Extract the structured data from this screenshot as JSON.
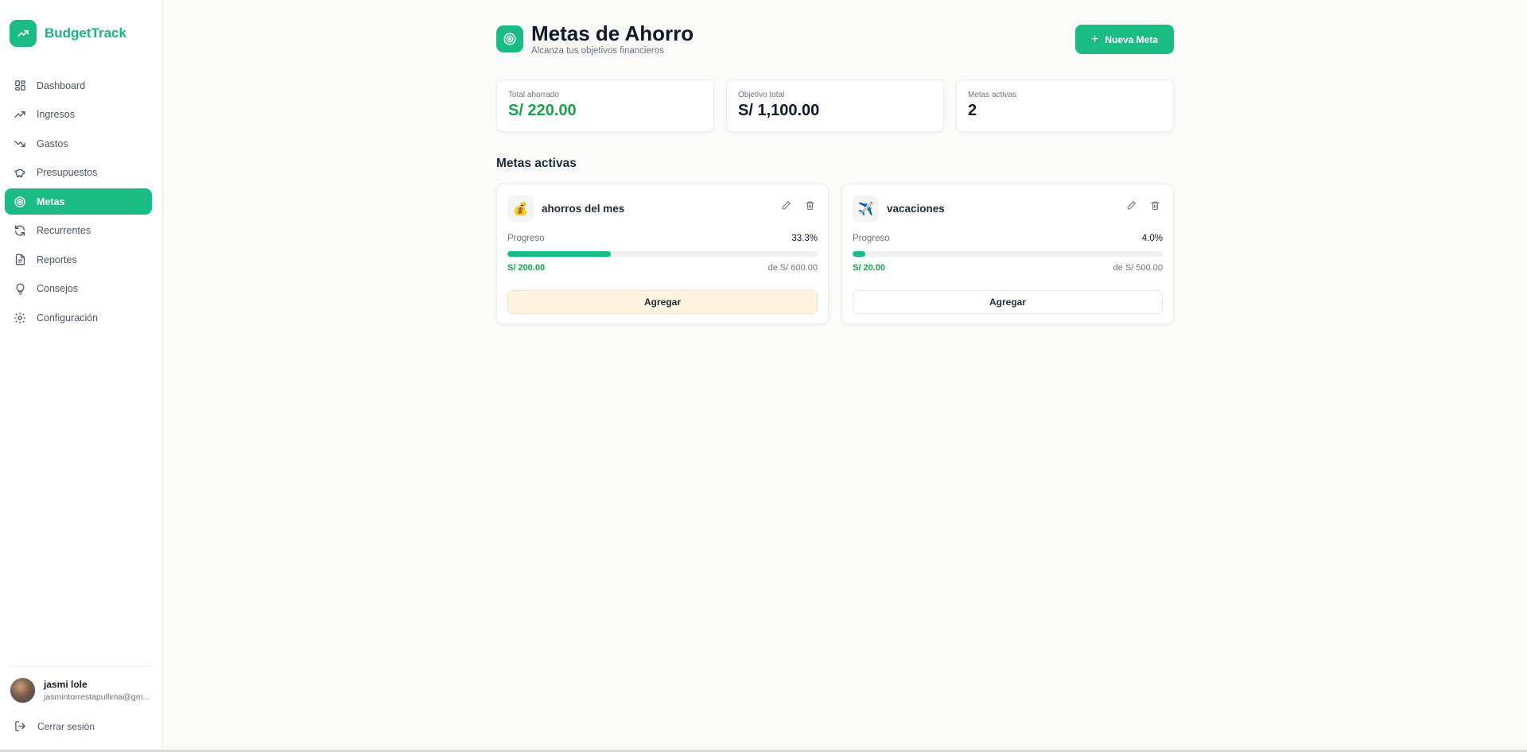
{
  "brand": {
    "name": "BudgetTrack",
    "color": "#1abc84"
  },
  "sidebar": {
    "items": [
      {
        "label": "Dashboard",
        "icon": "grid-icon",
        "active": false
      },
      {
        "label": "Ingresos",
        "icon": "trending-up-icon",
        "active": false
      },
      {
        "label": "Gastos",
        "icon": "trending-down-icon",
        "active": false
      },
      {
        "label": "Presupuestos",
        "icon": "piggy-bank-icon",
        "active": true
      },
      {
        "label": "Metas",
        "icon": "target-icon",
        "active": true
      },
      {
        "label": "Recurrentes",
        "icon": "refresh-icon",
        "active": false
      },
      {
        "label": "Reportes",
        "icon": "file-text-icon",
        "active": false
      },
      {
        "label": "Consejos",
        "icon": "lightbulb-icon",
        "active": false
      },
      {
        "label": "Configuración",
        "icon": "gear-icon",
        "active": false
      }
    ]
  },
  "user": {
    "name": "jasmi lole",
    "email": "jasmintorrestapullima@gm..."
  },
  "logout": {
    "label": "Cerrar sesión"
  },
  "header": {
    "title": "Metas de Ahorro",
    "subtitle": "Alcanza tus objetivos financieros",
    "new_button": "Nueva Meta"
  },
  "stats": [
    {
      "label": "Total ahorrado",
      "value": "S/ 220.00"
    },
    {
      "label": "Objetivo total",
      "value": "S/ 1,100.00"
    },
    {
      "label": "Metas activas",
      "value": "2"
    }
  ],
  "section": {
    "title": "Metas activas"
  },
  "goals": [
    {
      "emoji": "💰",
      "name": "ahorros del mes",
      "progress_label": "Progreso",
      "progress_text": "33.3%",
      "progress": 0.333,
      "saved": "S/ 200.00",
      "target": "de S/ 600.00",
      "button": "Agregar"
    },
    {
      "emoji": "✈️",
      "name": "vacaciones",
      "progress_label": "Progreso",
      "progress_text": "4.0%",
      "progress": 0.04,
      "saved": "S/ 20.00",
      "target": "de S/ 500.00",
      "button": "Agregar"
    }
  ]
}
